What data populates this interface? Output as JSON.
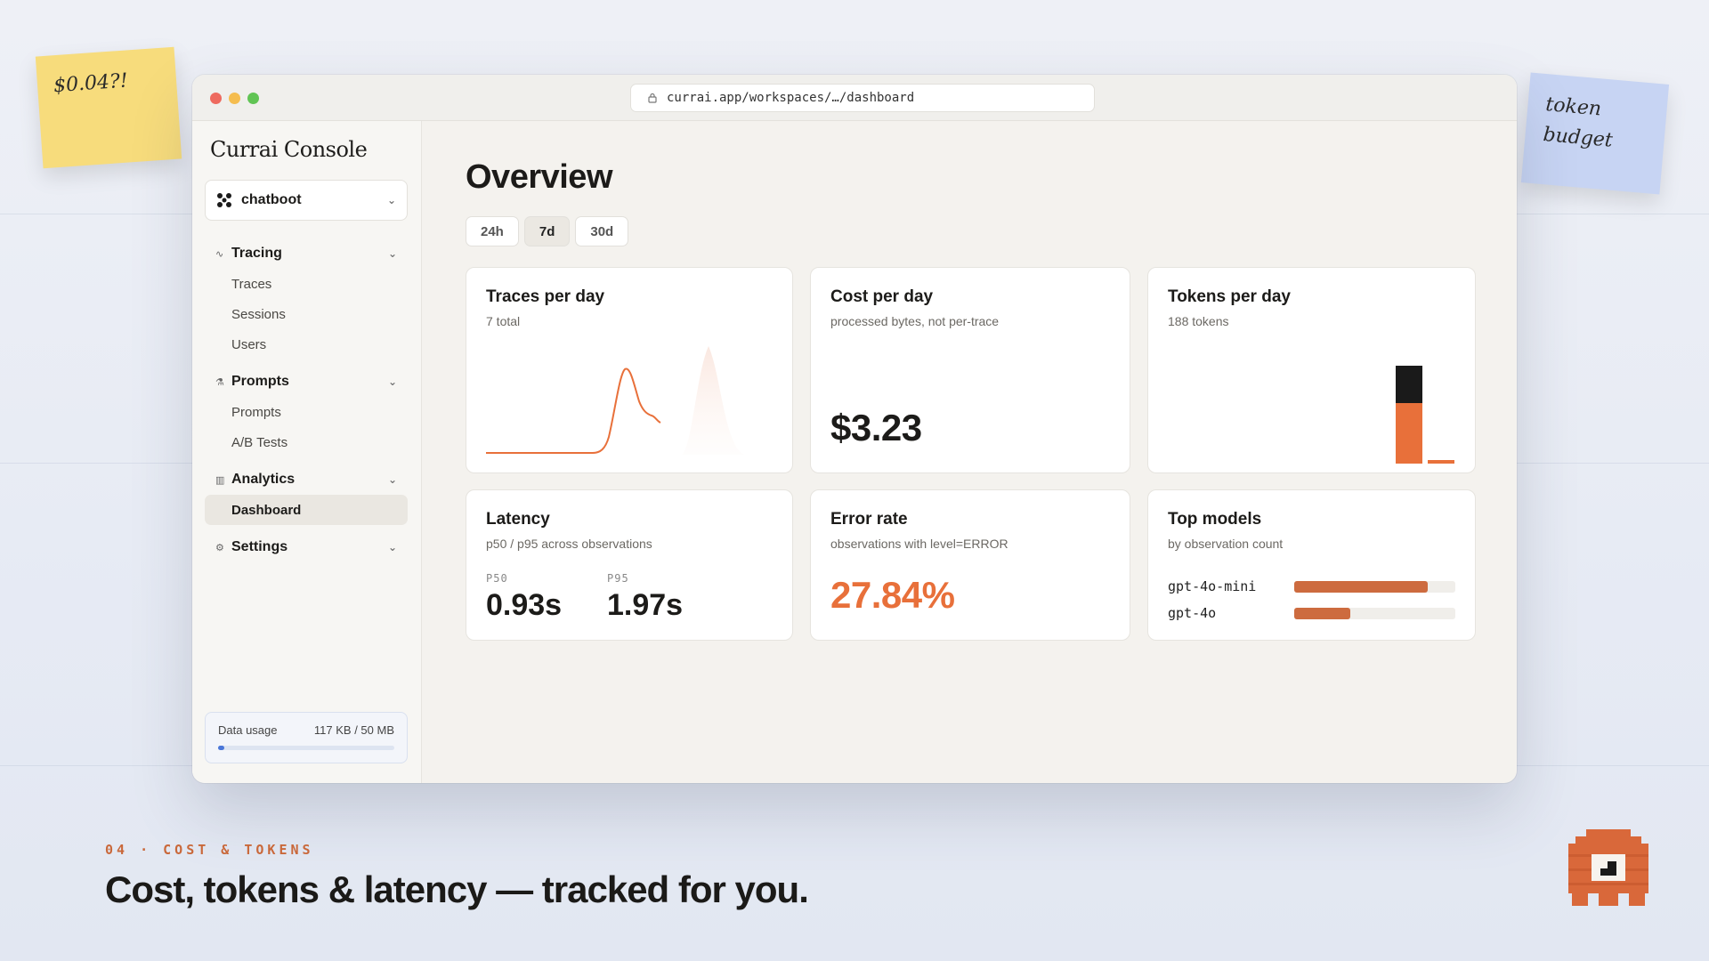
{
  "notes": {
    "left": "$0.04?!",
    "right_line1": "token",
    "right_line2": "budget"
  },
  "browser": {
    "url": "currai.app/workspaces/…/dashboard"
  },
  "sidebar": {
    "brand": "Currai Console",
    "project": "chatboot",
    "groups": [
      {
        "label": "Tracing",
        "items": [
          "Traces",
          "Sessions",
          "Users"
        ]
      },
      {
        "label": "Prompts",
        "items": [
          "Prompts",
          "A/B Tests"
        ]
      },
      {
        "label": "Analytics",
        "items": [
          "Dashboard"
        ]
      },
      {
        "label": "Settings",
        "items": []
      }
    ],
    "usage": {
      "label": "Data usage",
      "value": "117 KB / 50 MB",
      "fraction": 0.0023
    }
  },
  "main": {
    "title": "Overview",
    "ranges": [
      "24h",
      "7d",
      "30d"
    ],
    "active_range": "7d",
    "cards": {
      "traces": {
        "title": "Traces per day",
        "sub": "7 total"
      },
      "cost": {
        "title": "Cost per day",
        "sub": "processed bytes, not per-trace",
        "value": "$3.23"
      },
      "tokens": {
        "title": "Tokens per day",
        "sub": "188 tokens"
      },
      "latency": {
        "title": "Latency",
        "sub": "p50 / p95 across observations",
        "p50_label": "P50",
        "p50": "0.93s",
        "p95_label": "P95",
        "p95": "1.97s"
      },
      "error": {
        "title": "Error rate",
        "sub": "observations with level=ERROR",
        "value": "27.84%"
      },
      "models": {
        "title": "Top models",
        "sub": "by observation count",
        "rows": [
          {
            "name": "gpt-4o-mini",
            "share": 0.83
          },
          {
            "name": "gpt-4o",
            "share": 0.35
          }
        ]
      }
    }
  },
  "footer": {
    "tag": "04 · COST & TOKENS",
    "headline": "Cost, tokens & latency — tracked for you."
  },
  "colors": {
    "accent": "#e8703a",
    "dark": "#1a1a1a"
  }
}
